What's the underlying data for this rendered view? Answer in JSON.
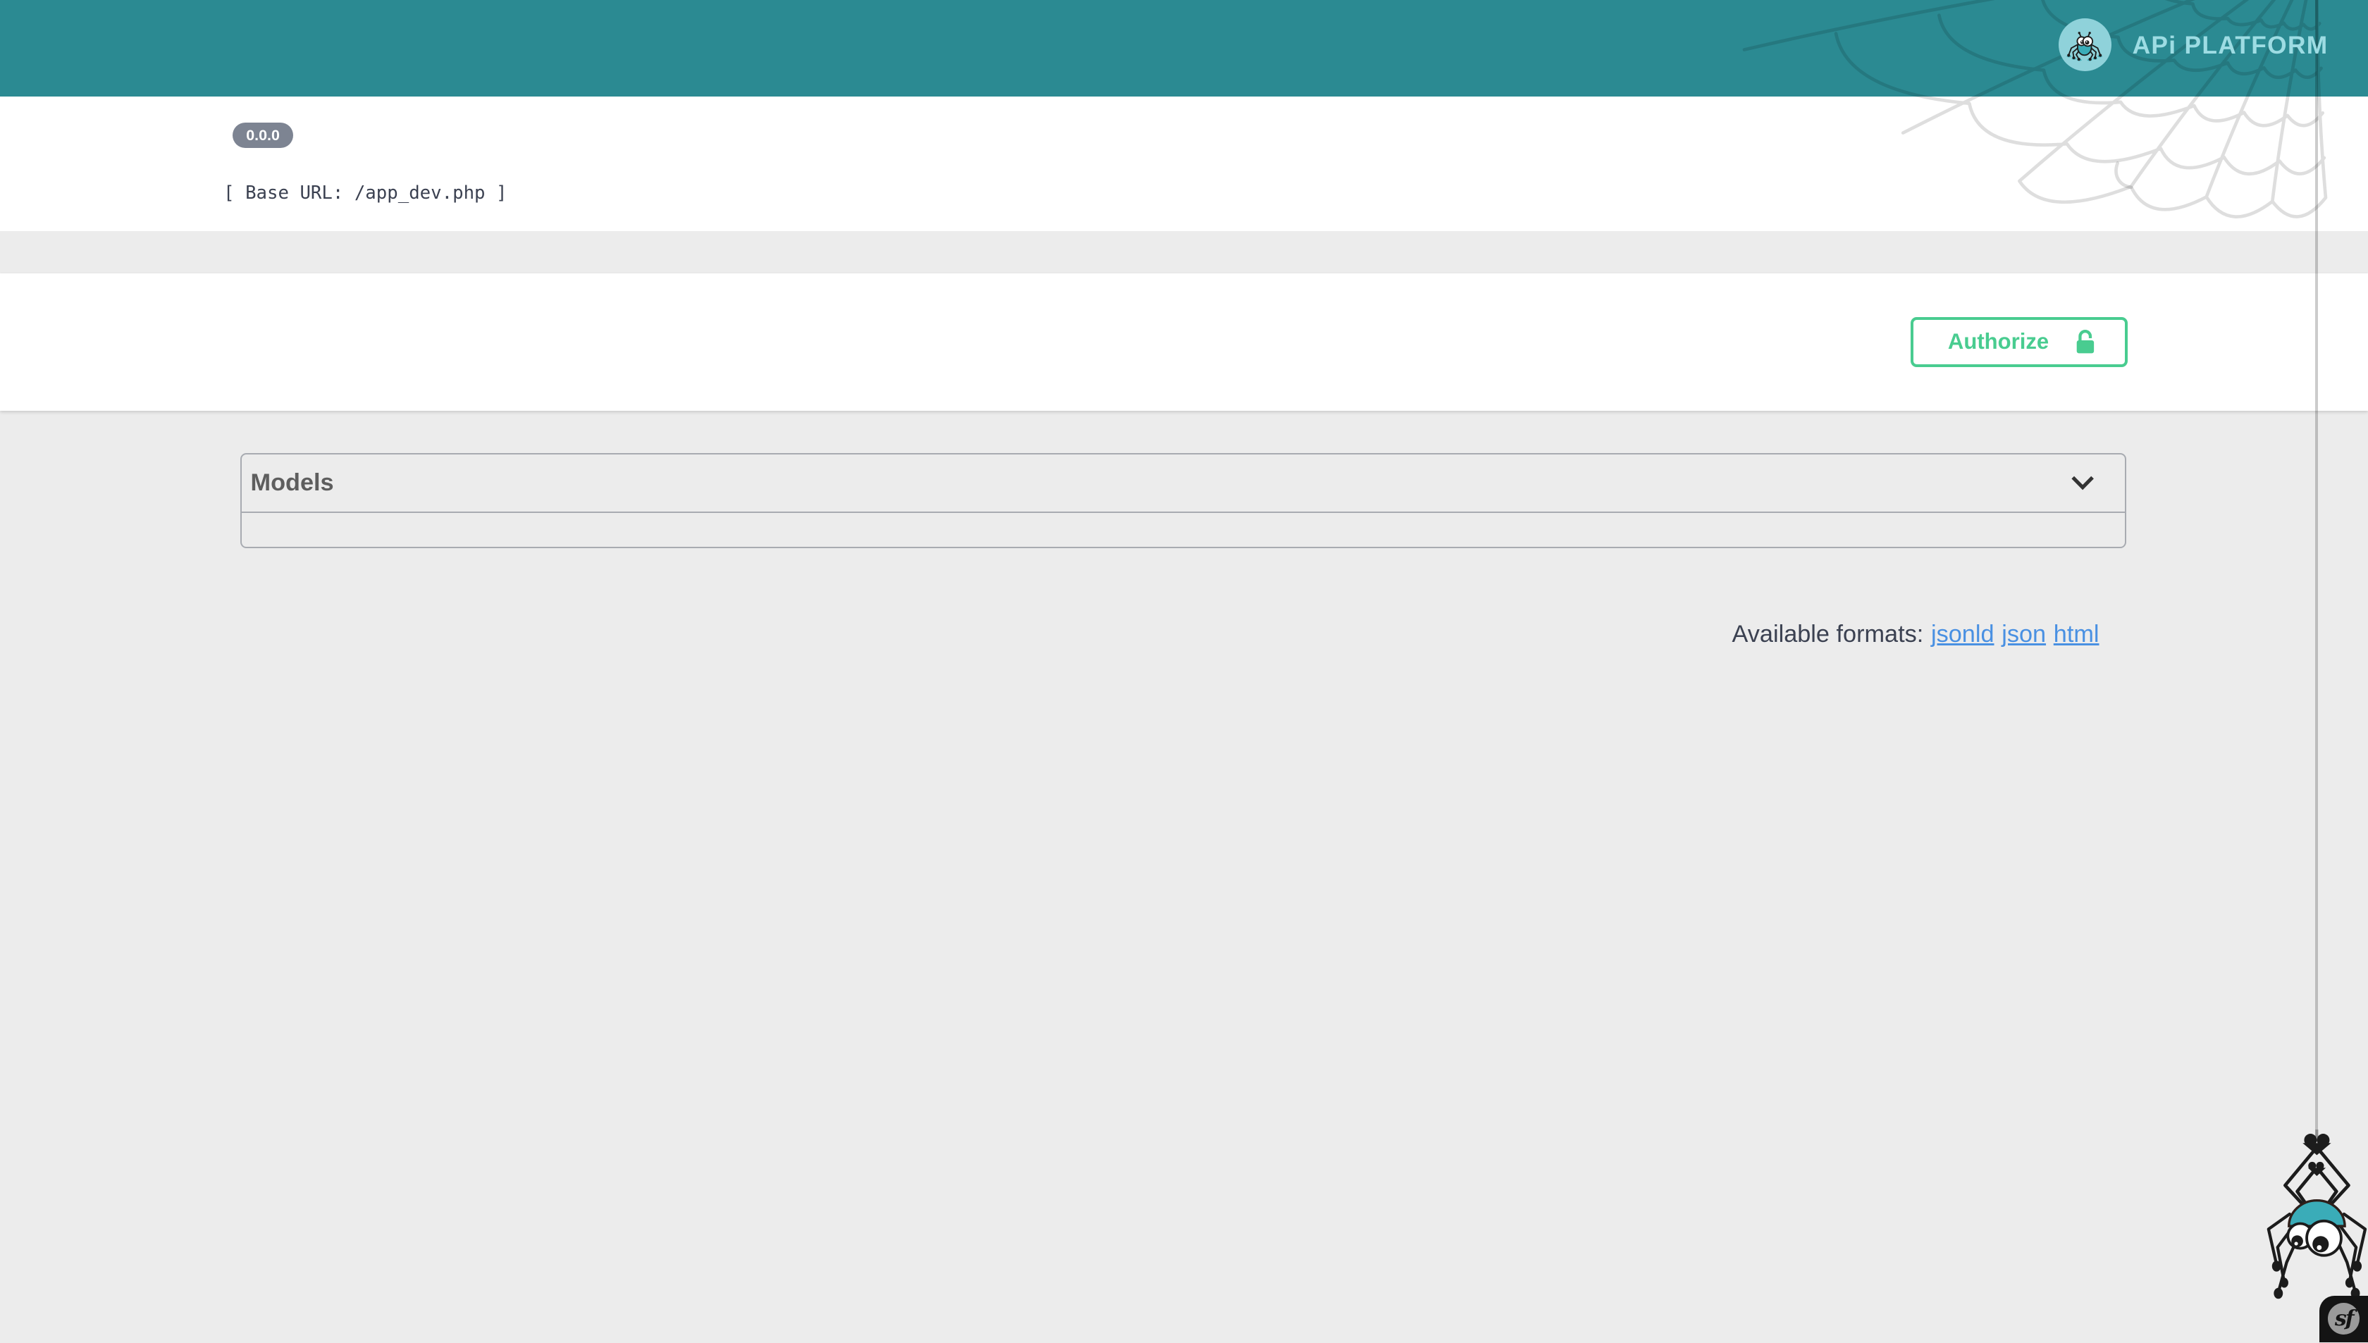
{
  "header": {
    "brand_text": "APi PLATFORM"
  },
  "info": {
    "version_badge": "0.0.0",
    "base_url": "[ Base URL: /app_dev.php ]"
  },
  "auth": {
    "authorize_label": "Authorize"
  },
  "models_section": {
    "title": "Models"
  },
  "formats": {
    "label": "Available formats:",
    "links": [
      "jsonld",
      "json",
      "html"
    ]
  },
  "footer": {
    "symfony_badge_text": "sf"
  },
  "colors": {
    "header_teal": "#2b8a92",
    "logo_circle_teal": "#8fd2da",
    "accent_green": "#49cc90",
    "link_blue": "#4990e2",
    "version_badge_gray": "#7d8492",
    "spider_head_teal": "#3aacb8",
    "text_dark": "#3b4151",
    "page_bg": "#ececec"
  }
}
